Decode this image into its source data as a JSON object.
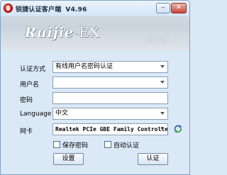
{
  "titlebar": {
    "title": "锐捷认证客户端",
    "version": "V4.96",
    "minimize_glyph": "‒",
    "close_glyph": "✕"
  },
  "banner": {
    "logo": "Ruijie",
    "logo_suffix": "-EX",
    "slogan": "创新 简单"
  },
  "form": {
    "auth_mode_label": "认证方式",
    "auth_mode_value": "有线用户名密码认证",
    "username_label": "用户名",
    "username_value": "",
    "password_label": "密码",
    "password_value": "",
    "language_label": "Language",
    "language_value": "中文",
    "nic_label": "网卡",
    "nic_value": "Realtek PCIe GBE Family Controlle:"
  },
  "options": {
    "save_password": "保存密码",
    "auto_auth": "自动认证"
  },
  "buttons": {
    "settings": "设置",
    "authenticate": "认证"
  },
  "colors": {
    "accent": "#c70e0e",
    "panel": "#dbe8f6"
  }
}
